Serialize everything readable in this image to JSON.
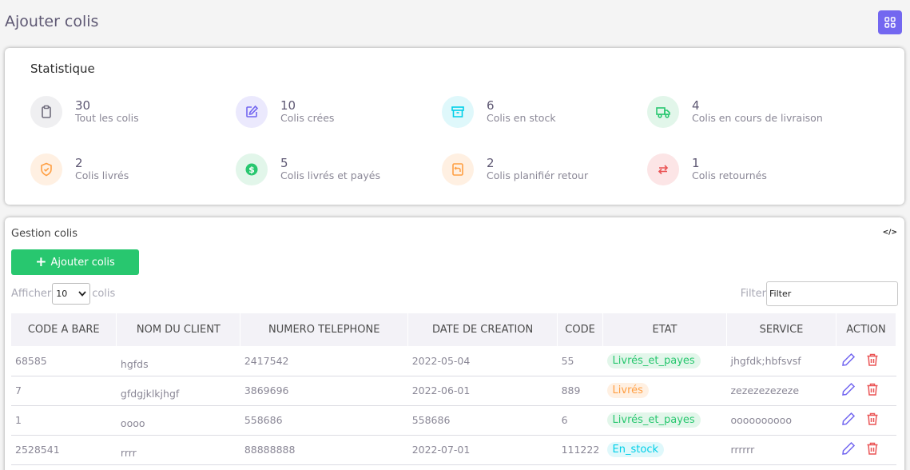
{
  "page": {
    "title": "Ajouter colis"
  },
  "header": {
    "grid_icon": "grid-icon"
  },
  "stats": {
    "title": "Statistique",
    "items": [
      {
        "value": "30",
        "label": "Tout les colis",
        "icon": "clipboard-icon",
        "color": "#6e6b7b",
        "bg": "#efeff1"
      },
      {
        "value": "10",
        "label": "Colis crées",
        "icon": "edit-icon",
        "color": "#7367f0",
        "bg": "#ebe9fd"
      },
      {
        "value": "6",
        "label": "Colis en stock",
        "icon": "archive-icon",
        "color": "#00cfe8",
        "bg": "#dff8fb"
      },
      {
        "value": "4",
        "label": "Colis en cours de livraison",
        "icon": "truck-icon",
        "color": "#28c76f",
        "bg": "#e2f6ea"
      },
      {
        "value": "2",
        "label": "Colis livrés",
        "icon": "shield-icon",
        "color": "#ff9f43",
        "bg": "#fff0e2"
      },
      {
        "value": "5",
        "label": "Colis livrés et payés",
        "icon": "dollar-icon",
        "color": "#28c76f",
        "bg": "#e2f6ea"
      },
      {
        "value": "2",
        "label": "Colis planifiér retour",
        "icon": "return-box-icon",
        "color": "#ff9f43",
        "bg": "#fff0e2"
      },
      {
        "value": "1",
        "label": "Colis retournés",
        "icon": "swap-icon",
        "color": "#ea5455",
        "bg": "#fce5e6"
      }
    ]
  },
  "management": {
    "title": "Gestion colis",
    "code_icon": "</>",
    "add_button": "Ajouter colis",
    "show_label": "Afficher",
    "page_size": "10",
    "show_suffix": "colis",
    "filter_label": "Filter",
    "filter_value": "Filter",
    "columns": [
      "CODE A BARE",
      "NOM DU CLIENT",
      "NUMERO TELEPHONE",
      "DATE DE CREATION",
      "CODE",
      "ETAT",
      "SERVICE",
      "ACTION"
    ],
    "rows": [
      {
        "code_barre": "68585",
        "nom": "hgfds",
        "tel": "2417542",
        "date": "2022-05-04",
        "code": "55",
        "etat": "Livrés_et_payes",
        "etat_color": "#28c76f",
        "etat_bg": "#e2f6ea",
        "service": "jhgfdk;hbfsvsf"
      },
      {
        "code_barre": "7",
        "nom": "gfdgjklkjhgf",
        "tel": "3869696",
        "date": "2022-06-01",
        "code": "889",
        "etat": "Livrés",
        "etat_color": "#ff9f43",
        "etat_bg": "#fff0e2",
        "service": "zezezezezeze"
      },
      {
        "code_barre": "1",
        "nom": "oooo",
        "tel": "558686",
        "date": "558686",
        "code": "6",
        "etat": "Livrés_et_payes",
        "etat_color": "#28c76f",
        "etat_bg": "#e2f6ea",
        "service": "oooooooooo"
      },
      {
        "code_barre": "2528541",
        "nom": "rrrr",
        "tel": "88888888",
        "date": "2022-07-01",
        "code": "111222",
        "etat": "En_stock",
        "etat_color": "#00cfe8",
        "etat_bg": "#dff8fb",
        "service": "rrrrrr"
      }
    ],
    "action_colors": {
      "edit": "#7367f0",
      "delete": "#ea5455"
    }
  }
}
